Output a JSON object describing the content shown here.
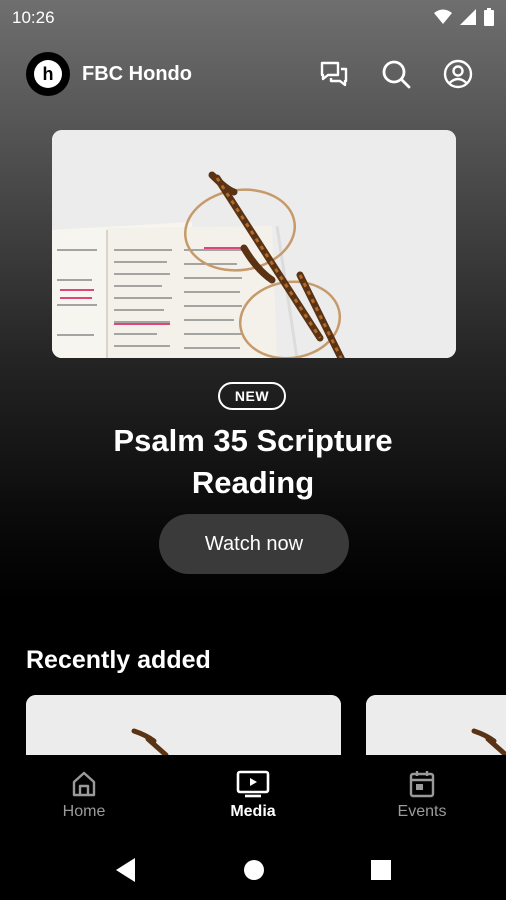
{
  "status_bar": {
    "time": "10:26"
  },
  "header": {
    "app_name": "FBC Hondo",
    "logo_letter": "h"
  },
  "hero": {
    "badge": "NEW",
    "title": "Psalm 35 Scripture Reading",
    "cta": "Watch now"
  },
  "recently_added": {
    "title": "Recently added"
  },
  "bottom_nav": {
    "items": [
      {
        "label": "Home",
        "icon": "home-icon",
        "active": false
      },
      {
        "label": "Media",
        "icon": "tv-play-icon",
        "active": true
      },
      {
        "label": "Events",
        "icon": "calendar-icon",
        "active": false
      }
    ]
  },
  "colors": {
    "background_top": "#6f6f6f",
    "background_bottom": "#000000",
    "button_bg": "#3a3a3a",
    "inactive_nav": "#9a9a9a"
  }
}
